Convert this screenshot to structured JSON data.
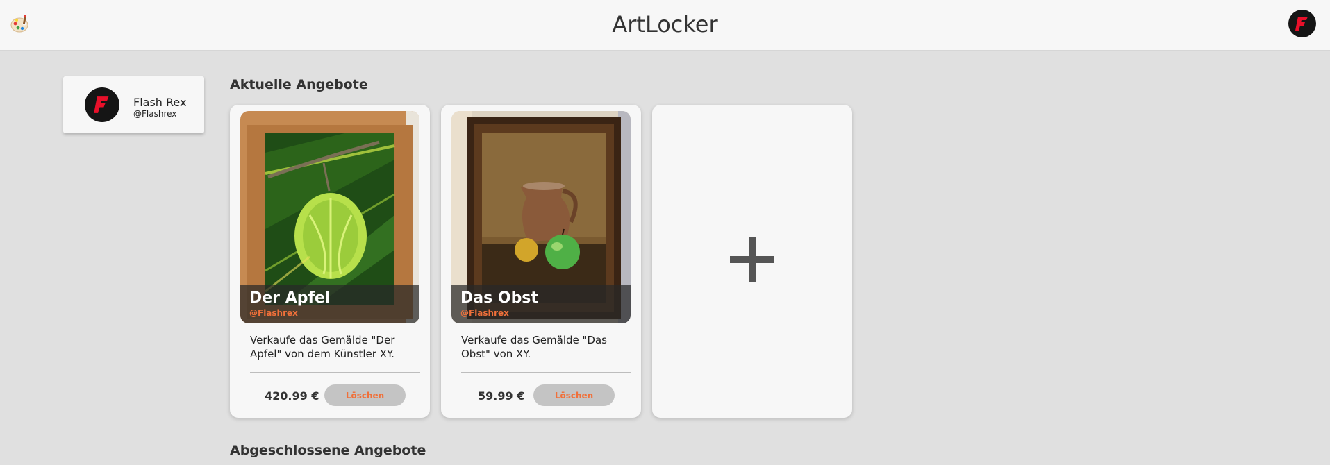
{
  "header": {
    "title": "ArtLocker",
    "logo_icon": "palette-icon",
    "avatar_icon": "flash-f-icon"
  },
  "profile": {
    "name": "Flash Rex",
    "handle": "@Flashrex",
    "avatar_icon": "flash-f-icon"
  },
  "sections": {
    "current_title": "Aktuelle Angebote",
    "completed_title": "Abgeschlossene Angebote"
  },
  "offers": [
    {
      "title": "Der Apfel",
      "handle": "@Flashrex",
      "description": "Verkaufe das Gemälde \"Der Apfel\" von dem Künstler XY.",
      "price": "420.99 €",
      "delete_label": "Löschen"
    },
    {
      "title": "Das Obst",
      "handle": "@Flashrex",
      "description": "Verkaufe das Gemälde \"Das Obst\" von XY.",
      "price": "59.99 €",
      "delete_label": "Löschen"
    }
  ],
  "add_card": {
    "icon": "plus-icon"
  },
  "colors": {
    "accent": "#f0703a",
    "logo_red": "#e8102a",
    "background": "#e0e0e0",
    "card": "#f7f7f7"
  }
}
